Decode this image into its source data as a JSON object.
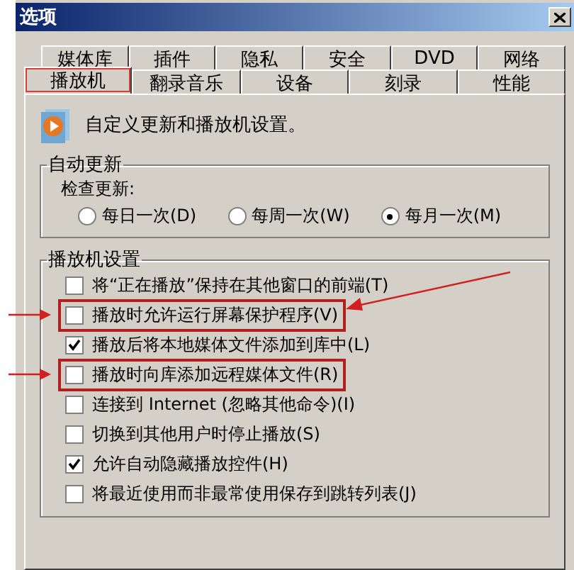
{
  "window": {
    "title": "选项"
  },
  "tabs_back": [
    {
      "label": "媒体库",
      "selected": false
    },
    {
      "label": "插件",
      "selected": false
    },
    {
      "label": "隐私",
      "selected": false
    },
    {
      "label": "安全",
      "selected": false
    },
    {
      "label": "DVD",
      "selected": false
    },
    {
      "label": "网络",
      "selected": false
    }
  ],
  "tabs_front": [
    {
      "label": "播放机",
      "selected": true,
      "marked": true
    },
    {
      "label": "翻录音乐",
      "selected": false,
      "marked": false
    },
    {
      "label": "设备",
      "selected": false,
      "marked": false
    },
    {
      "label": "刻录",
      "selected": false,
      "marked": false
    },
    {
      "label": "性能",
      "selected": false,
      "marked": false
    }
  ],
  "intro": "自定义更新和播放机设置。",
  "auto_update": {
    "title": "自动更新",
    "label": "检查更新:",
    "options": [
      {
        "label": "每日一次(D)",
        "selected": false
      },
      {
        "label": "每周一次(W)",
        "selected": false
      },
      {
        "label": "每月一次(M)",
        "selected": true
      }
    ]
  },
  "player_settings": {
    "title": "播放机设置",
    "items": [
      {
        "label": "将“正在播放”保持在其他窗口的前端(T)",
        "checked": false,
        "marked": false,
        "arrow_left": false,
        "arrow_right": false
      },
      {
        "label": "播放时允许运行屏幕保护程序(V)",
        "checked": false,
        "marked": true,
        "arrow_left": true,
        "arrow_right": true
      },
      {
        "label": "播放后将本地媒体文件添加到库中(L)",
        "checked": true,
        "marked": false,
        "arrow_left": false,
        "arrow_right": false
      },
      {
        "label": "播放时向库添加远程媒体文件(R)",
        "checked": false,
        "marked": true,
        "arrow_left": true,
        "arrow_right": false
      },
      {
        "label": "连接到 Internet (忽略其他命令)(I)",
        "checked": false,
        "marked": false,
        "arrow_left": false,
        "arrow_right": false
      },
      {
        "label": "切换到其他用户时停止播放(S)",
        "checked": false,
        "marked": false,
        "arrow_left": false,
        "arrow_right": false
      },
      {
        "label": "允许自动隐藏播放控件(H)",
        "checked": true,
        "marked": false,
        "arrow_left": false,
        "arrow_right": false
      },
      {
        "label": "将最近使用而非最常使用保存到跳转列表(J)",
        "checked": false,
        "marked": false,
        "arrow_left": false,
        "arrow_right": false
      }
    ]
  }
}
